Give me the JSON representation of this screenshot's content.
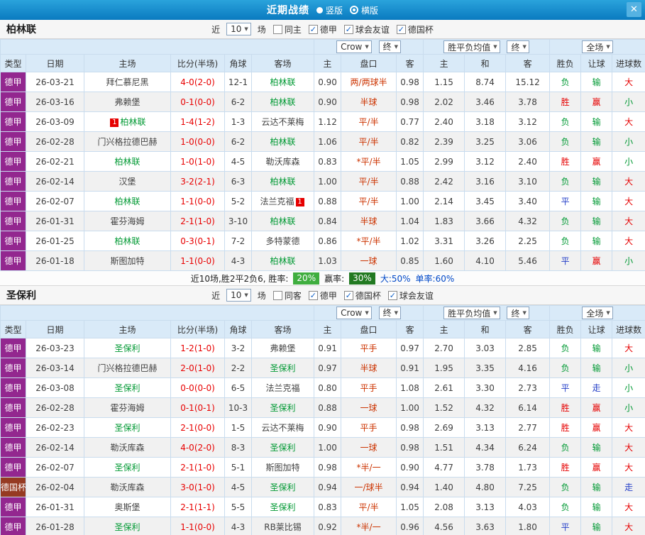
{
  "ui": {
    "dropdown_arrow": "▼",
    "check_glyph": "✓"
  },
  "header": {
    "title": "近期战绩",
    "options": [
      {
        "label": "竖版",
        "selected": false
      },
      {
        "label": "横版",
        "selected": true
      }
    ],
    "close_glyph": "✕"
  },
  "table_columns": [
    "类型",
    "日期",
    "主场",
    "比分(半场)",
    "角球",
    "客场",
    "主",
    "盘口",
    "客",
    "主",
    "和",
    "客",
    "胜负",
    "让球",
    "进球数"
  ],
  "sections": [
    {
      "team": "柏林联",
      "filter": {
        "near_label": "近",
        "count": "10",
        "unit_label": "场",
        "checkboxes": [
          {
            "label": "同主",
            "checked": false
          },
          {
            "label": "德甲",
            "checked": true
          },
          {
            "label": "球会友谊",
            "checked": true
          },
          {
            "label": "德国杯",
            "checked": true
          }
        ]
      },
      "dropdowns": {
        "company": "Crow",
        "company_time": "终",
        "avg": "胜平负均值",
        "avg_time": "终",
        "scope": "全场"
      },
      "rows": [
        {
          "league": "德甲",
          "league_color": "purple",
          "date": "26-03-21",
          "home": {
            "name": "拜仁慕尼黑",
            "focus": false,
            "badge": ""
          },
          "score": "4-0(2-0)",
          "corners": "12-1",
          "away": {
            "name": "柏林联",
            "focus": true,
            "badge": ""
          },
          "odds": [
            "0.90",
            "两/两球半",
            "0.98"
          ],
          "avg": [
            "1.15",
            "8.74",
            "15.12"
          ],
          "result": {
            "text": "负",
            "color": "green"
          },
          "handicap_result": {
            "text": "输",
            "color": "green"
          },
          "goals_result": {
            "text": "大",
            "color": "red"
          }
        },
        {
          "league": "德甲",
          "league_color": "purple",
          "date": "26-03-16",
          "home": {
            "name": "弗赖堡",
            "focus": false,
            "badge": ""
          },
          "score": "0-1(0-0)",
          "corners": "6-2",
          "away": {
            "name": "柏林联",
            "focus": true,
            "badge": ""
          },
          "odds": [
            "0.90",
            "半球",
            "0.98"
          ],
          "avg": [
            "2.02",
            "3.46",
            "3.78"
          ],
          "result": {
            "text": "胜",
            "color": "red"
          },
          "handicap_result": {
            "text": "赢",
            "color": "red"
          },
          "goals_result": {
            "text": "小",
            "color": "green"
          }
        },
        {
          "league": "德甲",
          "league_color": "purple",
          "date": "26-03-09",
          "home": {
            "name": "柏林联",
            "focus": true,
            "badge": "1"
          },
          "score": "1-4(1-2)",
          "corners": "1-3",
          "away": {
            "name": "云达不莱梅",
            "focus": false,
            "badge": ""
          },
          "odds": [
            "1.12",
            "平/半",
            "0.77"
          ],
          "avg": [
            "2.40",
            "3.18",
            "3.12"
          ],
          "result": {
            "text": "负",
            "color": "green"
          },
          "handicap_result": {
            "text": "输",
            "color": "green"
          },
          "goals_result": {
            "text": "大",
            "color": "red"
          }
        },
        {
          "league": "德甲",
          "league_color": "purple",
          "date": "26-02-28",
          "home": {
            "name": "门兴格拉德巴赫",
            "focus": false,
            "badge": ""
          },
          "score": "1-0(0-0)",
          "corners": "6-2",
          "away": {
            "name": "柏林联",
            "focus": true,
            "badge": ""
          },
          "odds": [
            "1.06",
            "平/半",
            "0.82"
          ],
          "avg": [
            "2.39",
            "3.25",
            "3.06"
          ],
          "result": {
            "text": "负",
            "color": "green"
          },
          "handicap_result": {
            "text": "输",
            "color": "green"
          },
          "goals_result": {
            "text": "小",
            "color": "green"
          }
        },
        {
          "league": "德甲",
          "league_color": "purple",
          "date": "26-02-21",
          "home": {
            "name": "柏林联",
            "focus": true,
            "badge": ""
          },
          "score": "1-0(1-0)",
          "corners": "4-5",
          "away": {
            "name": "勒沃库森",
            "focus": false,
            "badge": ""
          },
          "odds": [
            "0.83",
            "*平/半",
            "1.05"
          ],
          "avg": [
            "2.99",
            "3.12",
            "2.40"
          ],
          "result": {
            "text": "胜",
            "color": "red"
          },
          "handicap_result": {
            "text": "赢",
            "color": "red"
          },
          "goals_result": {
            "text": "小",
            "color": "green"
          }
        },
        {
          "league": "德甲",
          "league_color": "purple",
          "date": "26-02-14",
          "home": {
            "name": "汉堡",
            "focus": false,
            "badge": ""
          },
          "score": "3-2(2-1)",
          "corners": "6-3",
          "away": {
            "name": "柏林联",
            "focus": true,
            "badge": ""
          },
          "odds": [
            "1.00",
            "平/半",
            "0.88"
          ],
          "avg": [
            "2.42",
            "3.16",
            "3.10"
          ],
          "result": {
            "text": "负",
            "color": "green"
          },
          "handicap_result": {
            "text": "输",
            "color": "green"
          },
          "goals_result": {
            "text": "大",
            "color": "red"
          }
        },
        {
          "league": "德甲",
          "league_color": "purple",
          "date": "26-02-07",
          "home": {
            "name": "柏林联",
            "focus": true,
            "badge": ""
          },
          "score": "1-1(0-0)",
          "corners": "5-2",
          "away": {
            "name": "法兰克福",
            "focus": false,
            "badge": "1"
          },
          "odds": [
            "0.88",
            "平/半",
            "1.00"
          ],
          "avg": [
            "2.14",
            "3.45",
            "3.40"
          ],
          "result": {
            "text": "平",
            "color": "blue"
          },
          "handicap_result": {
            "text": "输",
            "color": "green"
          },
          "goals_result": {
            "text": "大",
            "color": "red"
          }
        },
        {
          "league": "德甲",
          "league_color": "purple",
          "date": "26-01-31",
          "home": {
            "name": "霍芬海姆",
            "focus": false,
            "badge": ""
          },
          "score": "2-1(1-0)",
          "corners": "3-10",
          "away": {
            "name": "柏林联",
            "focus": true,
            "badge": ""
          },
          "odds": [
            "0.84",
            "半球",
            "1.04"
          ],
          "avg": [
            "1.83",
            "3.66",
            "4.32"
          ],
          "result": {
            "text": "负",
            "color": "green"
          },
          "handicap_result": {
            "text": "输",
            "color": "green"
          },
          "goals_result": {
            "text": "大",
            "color": "red"
          }
        },
        {
          "league": "德甲",
          "league_color": "purple",
          "date": "26-01-25",
          "home": {
            "name": "柏林联",
            "focus": true,
            "badge": ""
          },
          "score": "0-3(0-1)",
          "corners": "7-2",
          "away": {
            "name": "多特蒙德",
            "focus": false,
            "badge": ""
          },
          "odds": [
            "0.86",
            "*平/半",
            "1.02"
          ],
          "avg": [
            "3.31",
            "3.26",
            "2.25"
          ],
          "result": {
            "text": "负",
            "color": "green"
          },
          "handicap_result": {
            "text": "输",
            "color": "green"
          },
          "goals_result": {
            "text": "大",
            "color": "red"
          }
        },
        {
          "league": "德甲",
          "league_color": "purple",
          "date": "26-01-18",
          "home": {
            "name": "斯图加特",
            "focus": false,
            "badge": ""
          },
          "score": "1-1(0-0)",
          "corners": "4-3",
          "away": {
            "name": "柏林联",
            "focus": true,
            "badge": ""
          },
          "odds": [
            "1.03",
            "一球",
            "0.85"
          ],
          "avg": [
            "1.60",
            "4.10",
            "5.46"
          ],
          "result": {
            "text": "平",
            "color": "blue"
          },
          "handicap_result": {
            "text": "赢",
            "color": "red"
          },
          "goals_result": {
            "text": "小",
            "color": "green"
          }
        }
      ],
      "summary": {
        "prefix": "近10场,胜2平2负6, 胜率:",
        "win_rate": "20%",
        "cover_label": "赢率:",
        "cover_rate": "30%",
        "big_label": "大:50%",
        "single_label": "单率:60%"
      }
    },
    {
      "team": "圣保利",
      "filter": {
        "near_label": "近",
        "count": "10",
        "unit_label": "场",
        "checkboxes": [
          {
            "label": "同客",
            "checked": false
          },
          {
            "label": "德甲",
            "checked": true
          },
          {
            "label": "德国杯",
            "checked": true
          },
          {
            "label": "球会友谊",
            "checked": true
          }
        ]
      },
      "dropdowns": {
        "company": "Crow",
        "company_time": "终",
        "avg": "胜平负均值",
        "avg_time": "终",
        "scope": "全场"
      },
      "rows": [
        {
          "league": "德甲",
          "league_color": "purple",
          "date": "26-03-23",
          "home": {
            "name": "圣保利",
            "focus": true,
            "badge": ""
          },
          "score": "1-2(1-0)",
          "corners": "3-2",
          "away": {
            "name": "弗赖堡",
            "focus": false,
            "badge": ""
          },
          "odds": [
            "0.91",
            "平手",
            "0.97"
          ],
          "avg": [
            "2.70",
            "3.03",
            "2.85"
          ],
          "result": {
            "text": "负",
            "color": "green"
          },
          "handicap_result": {
            "text": "输",
            "color": "green"
          },
          "goals_result": {
            "text": "大",
            "color": "red"
          }
        },
        {
          "league": "德甲",
          "league_color": "purple",
          "date": "26-03-14",
          "home": {
            "name": "门兴格拉德巴赫",
            "focus": false,
            "badge": ""
          },
          "score": "2-0(1-0)",
          "corners": "2-2",
          "away": {
            "name": "圣保利",
            "focus": true,
            "badge": ""
          },
          "odds": [
            "0.97",
            "半球",
            "0.91"
          ],
          "avg": [
            "1.95",
            "3.35",
            "4.16"
          ],
          "result": {
            "text": "负",
            "color": "green"
          },
          "handicap_result": {
            "text": "输",
            "color": "green"
          },
          "goals_result": {
            "text": "小",
            "color": "green"
          }
        },
        {
          "league": "德甲",
          "league_color": "purple",
          "date": "26-03-08",
          "home": {
            "name": "圣保利",
            "focus": true,
            "badge": ""
          },
          "score": "0-0(0-0)",
          "corners": "6-5",
          "away": {
            "name": "法兰克福",
            "focus": false,
            "badge": ""
          },
          "odds": [
            "0.80",
            "平手",
            "1.08"
          ],
          "avg": [
            "2.61",
            "3.30",
            "2.73"
          ],
          "result": {
            "text": "平",
            "color": "blue"
          },
          "handicap_result": {
            "text": "走",
            "color": "blue"
          },
          "goals_result": {
            "text": "小",
            "color": "green"
          }
        },
        {
          "league": "德甲",
          "league_color": "purple",
          "date": "26-02-28",
          "home": {
            "name": "霍芬海姆",
            "focus": false,
            "badge": ""
          },
          "score": "0-1(0-1)",
          "corners": "10-3",
          "away": {
            "name": "圣保利",
            "focus": true,
            "badge": ""
          },
          "odds": [
            "0.88",
            "一球",
            "1.00"
          ],
          "avg": [
            "1.52",
            "4.32",
            "6.14"
          ],
          "result": {
            "text": "胜",
            "color": "red"
          },
          "handicap_result": {
            "text": "赢",
            "color": "red"
          },
          "goals_result": {
            "text": "小",
            "color": "green"
          }
        },
        {
          "league": "德甲",
          "league_color": "purple",
          "date": "26-02-23",
          "home": {
            "name": "圣保利",
            "focus": true,
            "badge": ""
          },
          "score": "2-1(0-0)",
          "corners": "1-5",
          "away": {
            "name": "云达不莱梅",
            "focus": false,
            "badge": ""
          },
          "odds": [
            "0.90",
            "平手",
            "0.98"
          ],
          "avg": [
            "2.69",
            "3.13",
            "2.77"
          ],
          "result": {
            "text": "胜",
            "color": "red"
          },
          "handicap_result": {
            "text": "赢",
            "color": "red"
          },
          "goals_result": {
            "text": "大",
            "color": "red"
          }
        },
        {
          "league": "德甲",
          "league_color": "purple",
          "date": "26-02-14",
          "home": {
            "name": "勒沃库森",
            "focus": false,
            "badge": ""
          },
          "score": "4-0(2-0)",
          "corners": "8-3",
          "away": {
            "name": "圣保利",
            "focus": true,
            "badge": ""
          },
          "odds": [
            "1.00",
            "一球",
            "0.98"
          ],
          "avg": [
            "1.51",
            "4.34",
            "6.24"
          ],
          "result": {
            "text": "负",
            "color": "green"
          },
          "handicap_result": {
            "text": "输",
            "color": "green"
          },
          "goals_result": {
            "text": "大",
            "color": "red"
          }
        },
        {
          "league": "德甲",
          "league_color": "purple",
          "date": "26-02-07",
          "home": {
            "name": "圣保利",
            "focus": true,
            "badge": ""
          },
          "score": "2-1(1-0)",
          "corners": "5-1",
          "away": {
            "name": "斯图加特",
            "focus": false,
            "badge": ""
          },
          "odds": [
            "0.98",
            "*半/一",
            "0.90"
          ],
          "avg": [
            "4.77",
            "3.78",
            "1.73"
          ],
          "result": {
            "text": "胜",
            "color": "red"
          },
          "handicap_result": {
            "text": "赢",
            "color": "red"
          },
          "goals_result": {
            "text": "大",
            "color": "red"
          }
        },
        {
          "league": "德国杯",
          "league_color": "darkred",
          "date": "26-02-04",
          "home": {
            "name": "勒沃库森",
            "focus": false,
            "badge": ""
          },
          "score": "3-0(1-0)",
          "corners": "4-5",
          "away": {
            "name": "圣保利",
            "focus": true,
            "badge": ""
          },
          "odds": [
            "0.94",
            "一/球半",
            "0.94"
          ],
          "avg": [
            "1.40",
            "4.80",
            "7.25"
          ],
          "result": {
            "text": "负",
            "color": "green"
          },
          "handicap_result": {
            "text": "输",
            "color": "green"
          },
          "goals_result": {
            "text": "走",
            "color": "blue"
          }
        },
        {
          "league": "德甲",
          "league_color": "purple",
          "date": "26-01-31",
          "home": {
            "name": "奥斯堡",
            "focus": false,
            "badge": ""
          },
          "score": "2-1(1-1)",
          "corners": "5-5",
          "away": {
            "name": "圣保利",
            "focus": true,
            "badge": ""
          },
          "odds": [
            "0.83",
            "平/半",
            "1.05"
          ],
          "avg": [
            "2.08",
            "3.13",
            "4.03"
          ],
          "result": {
            "text": "负",
            "color": "green"
          },
          "handicap_result": {
            "text": "输",
            "color": "green"
          },
          "goals_result": {
            "text": "大",
            "color": "red"
          }
        },
        {
          "league": "德甲",
          "league_color": "purple",
          "date": "26-01-28",
          "home": {
            "name": "圣保利",
            "focus": true,
            "badge": ""
          },
          "score": "1-1(0-0)",
          "corners": "4-3",
          "away": {
            "name": "RB莱比锡",
            "focus": false,
            "badge": ""
          },
          "odds": [
            "0.92",
            "*半/一",
            "0.96"
          ],
          "avg": [
            "4.56",
            "3.63",
            "1.80"
          ],
          "result": {
            "text": "平",
            "color": "blue"
          },
          "handicap_result": {
            "text": "输",
            "color": "green"
          },
          "goals_result": {
            "text": "大",
            "color": "red"
          }
        }
      ]
    }
  ]
}
